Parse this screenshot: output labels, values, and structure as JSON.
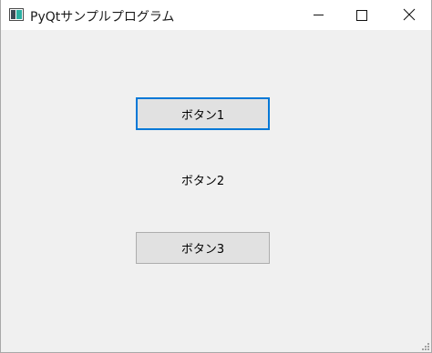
{
  "window": {
    "title": "PyQtサンプルプログラム",
    "controls": {
      "minimize_icon": "minimize-icon",
      "maximize_icon": "maximize-icon",
      "close_icon": "close-icon"
    }
  },
  "content": {
    "button1_label": "ボタン1",
    "label2_text": "ボタン2",
    "button3_label": "ボタン3"
  },
  "colors": {
    "client_bg": "#f0f0f0",
    "button_bg": "#e1e1e1",
    "focus_border": "#0078d7"
  }
}
